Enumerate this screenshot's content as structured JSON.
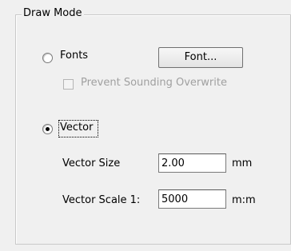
{
  "group": {
    "title": "Draw Mode"
  },
  "fonts": {
    "radio_label": "Fonts",
    "selected": false,
    "button_label": "Font...",
    "prevent_label": "Prevent Sounding Overwrite",
    "prevent_checked": false,
    "prevent_enabled": false
  },
  "vector": {
    "radio_label": "Vector",
    "selected": true,
    "size_label": "Vector Size",
    "size_value": "2.00",
    "size_unit": "mm",
    "scale_label": "Vector Scale 1:",
    "scale_value": "5000",
    "scale_unit": "m:m"
  }
}
